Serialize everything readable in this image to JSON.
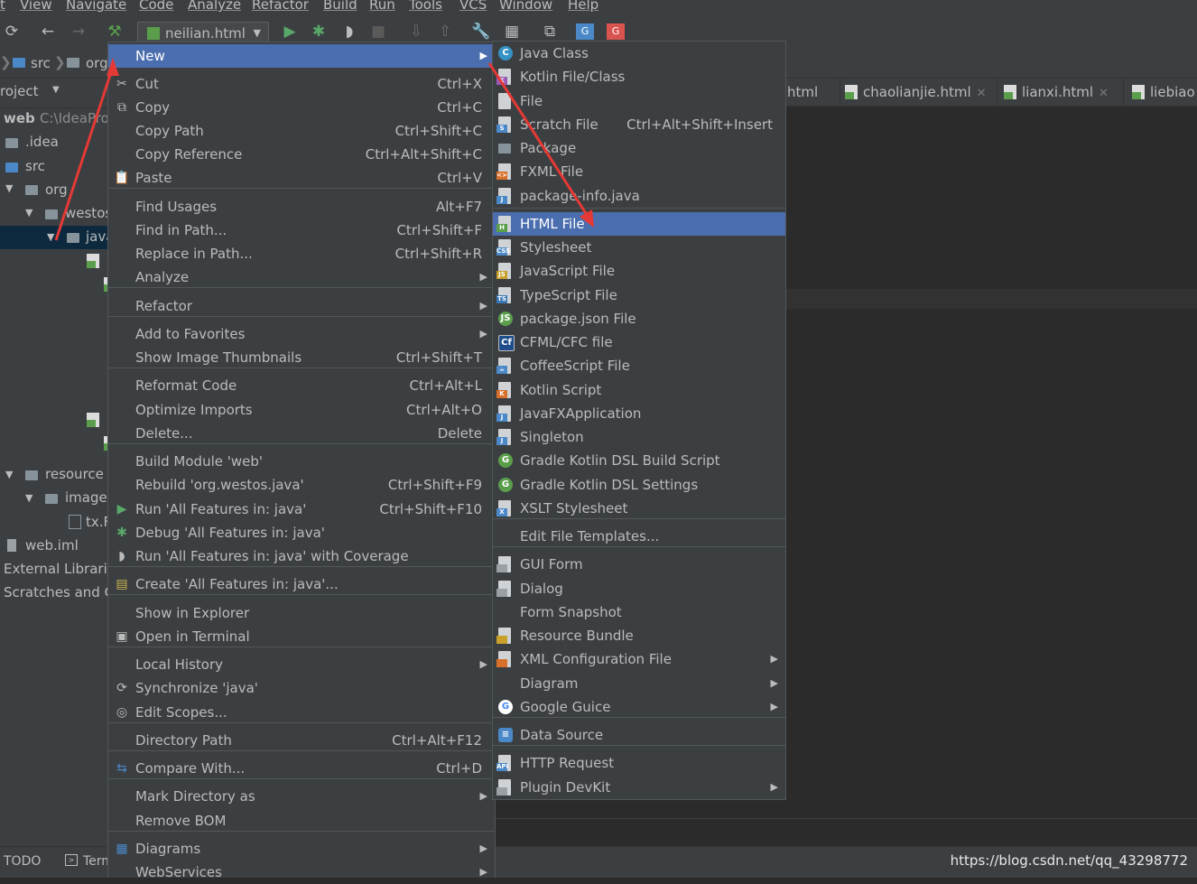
{
  "menubar": [
    "t",
    "View",
    "Navigate",
    "Code",
    "Analyze",
    "Refactor",
    "Build",
    "Run",
    "Tools",
    "VCS",
    "Window",
    "Help"
  ],
  "toolbar": {
    "run_config": "neilian.html"
  },
  "breadcrumb": [
    "src",
    "org"
  ],
  "project": {
    "title": "roject",
    "root_name": "web",
    "root_path": "C:\\IdeaPro",
    "items": [
      ".idea",
      "src",
      "org",
      "westos",
      "java",
      "resource",
      "image",
      "tx.F",
      "web.iml",
      "External Librarie",
      "Scratches and C"
    ]
  },
  "tabs": [
    {
      "label": "html"
    },
    {
      "label": "chaolianjie.html"
    },
    {
      "label": "lianxi.html"
    },
    {
      "label": "liebiao"
    }
  ],
  "context_menu": {
    "items": [
      {
        "label": "New",
        "shortcut": "",
        "icon": "none"
      },
      {
        "label": "Cut",
        "shortcut": "Ctrl+X",
        "icon": "scissors-icon"
      },
      {
        "label": "Copy",
        "shortcut": "Ctrl+C",
        "icon": "copy-icon"
      },
      {
        "label": "Copy Path",
        "shortcut": "Ctrl+Shift+C",
        "icon": "none"
      },
      {
        "label": "Copy Reference",
        "shortcut": "Ctrl+Alt+Shift+C",
        "icon": "none"
      },
      {
        "label": "Paste",
        "shortcut": "Ctrl+V",
        "icon": "paste-icon"
      },
      {
        "label": "Find Usages",
        "shortcut": "Alt+F7",
        "icon": "none"
      },
      {
        "label": "Find in Path...",
        "shortcut": "Ctrl+Shift+F",
        "icon": "none"
      },
      {
        "label": "Replace in Path...",
        "shortcut": "Ctrl+Shift+R",
        "icon": "none"
      },
      {
        "label": "Analyze",
        "shortcut": "",
        "icon": "none"
      },
      {
        "label": "Refactor",
        "shortcut": "",
        "icon": "none"
      },
      {
        "label": "Add to Favorites",
        "shortcut": "",
        "icon": "none"
      },
      {
        "label": "Show Image Thumbnails",
        "shortcut": "Ctrl+Shift+T",
        "icon": "none"
      },
      {
        "label": "Reformat Code",
        "shortcut": "Ctrl+Alt+L",
        "icon": "none"
      },
      {
        "label": "Optimize Imports",
        "shortcut": "Ctrl+Alt+O",
        "icon": "none"
      },
      {
        "label": "Delete...",
        "shortcut": "Delete",
        "icon": "none"
      },
      {
        "label": "Build Module 'web'",
        "shortcut": "",
        "icon": "none"
      },
      {
        "label": "Rebuild 'org.westos.java'",
        "shortcut": "Ctrl+Shift+F9",
        "icon": "none"
      },
      {
        "label": "Run 'All Features in: java'",
        "shortcut": "Ctrl+Shift+F10",
        "icon": "run-icon"
      },
      {
        "label": "Debug 'All Features in: java'",
        "shortcut": "",
        "icon": "debug-icon"
      },
      {
        "label": "Run 'All Features in: java' with Coverage",
        "shortcut": "",
        "icon": "coverage-icon"
      },
      {
        "label": "Create 'All Features in: java'...",
        "shortcut": "",
        "icon": "create-config-icon"
      },
      {
        "label": "Show in Explorer",
        "shortcut": "",
        "icon": "none"
      },
      {
        "label": "Open in Terminal",
        "shortcut": "",
        "icon": "terminal-icon"
      },
      {
        "label": "Local History",
        "shortcut": "",
        "icon": "none"
      },
      {
        "label": "Synchronize 'java'",
        "shortcut": "",
        "icon": "sync-icon"
      },
      {
        "label": "Edit Scopes...",
        "shortcut": "",
        "icon": "scope-icon"
      },
      {
        "label": "Directory Path",
        "shortcut": "Ctrl+Alt+F12",
        "icon": "none"
      },
      {
        "label": "Compare With...",
        "shortcut": "Ctrl+D",
        "icon": "compare-icon"
      },
      {
        "label": "Mark Directory as",
        "shortcut": "",
        "icon": "none"
      },
      {
        "label": "Remove BOM",
        "shortcut": "",
        "icon": "none"
      },
      {
        "label": "Diagrams",
        "shortcut": "",
        "icon": "diagrams-icon"
      },
      {
        "label": "WebServices",
        "shortcut": "",
        "icon": "none"
      }
    ]
  },
  "new_submenu": {
    "items": [
      {
        "label": "Java Class",
        "shortcut": ""
      },
      {
        "label": "Kotlin File/Class",
        "shortcut": ""
      },
      {
        "label": "File",
        "shortcut": ""
      },
      {
        "label": "Scratch File",
        "shortcut": "Ctrl+Alt+Shift+Insert"
      },
      {
        "label": "Package",
        "shortcut": ""
      },
      {
        "label": "FXML File",
        "shortcut": ""
      },
      {
        "label": "package-info.java",
        "shortcut": ""
      },
      {
        "label": "HTML File",
        "shortcut": ""
      },
      {
        "label": "Stylesheet",
        "shortcut": ""
      },
      {
        "label": "JavaScript File",
        "shortcut": ""
      },
      {
        "label": "TypeScript File",
        "shortcut": ""
      },
      {
        "label": "package.json File",
        "shortcut": ""
      },
      {
        "label": "CFML/CFC file",
        "shortcut": ""
      },
      {
        "label": "CoffeeScript File",
        "shortcut": ""
      },
      {
        "label": "Kotlin Script",
        "shortcut": ""
      },
      {
        "label": "JavaFXApplication",
        "shortcut": ""
      },
      {
        "label": "Singleton",
        "shortcut": ""
      },
      {
        "label": "Gradle Kotlin DSL Build Script",
        "shortcut": ""
      },
      {
        "label": "Gradle Kotlin DSL Settings",
        "shortcut": ""
      },
      {
        "label": "XSLT Stylesheet",
        "shortcut": ""
      },
      {
        "label": "Edit File Templates...",
        "shortcut": ""
      },
      {
        "label": "GUI Form",
        "shortcut": ""
      },
      {
        "label": "Dialog",
        "shortcut": ""
      },
      {
        "label": "Form Snapshot",
        "shortcut": ""
      },
      {
        "label": "Resource Bundle",
        "shortcut": ""
      },
      {
        "label": "XML Configuration File",
        "shortcut": ""
      },
      {
        "label": "Diagram",
        "shortcut": ""
      },
      {
        "label": "Google Guice",
        "shortcut": ""
      },
      {
        "label": "Data Source",
        "shortcut": ""
      },
      {
        "label": "HTTP Request",
        "shortcut": ""
      },
      {
        "label": "Plugin DevKit",
        "shortcut": ""
      }
    ]
  },
  "bottom": {
    "todo": "TODO",
    "terminal": "Term"
  },
  "watermark": "https://blog.csdn.net/qq_43298772",
  "colors": {
    "selection": "#4b6eaf",
    "annotation_arrow": "#e53935",
    "menu_bg": "#3c3f41"
  }
}
